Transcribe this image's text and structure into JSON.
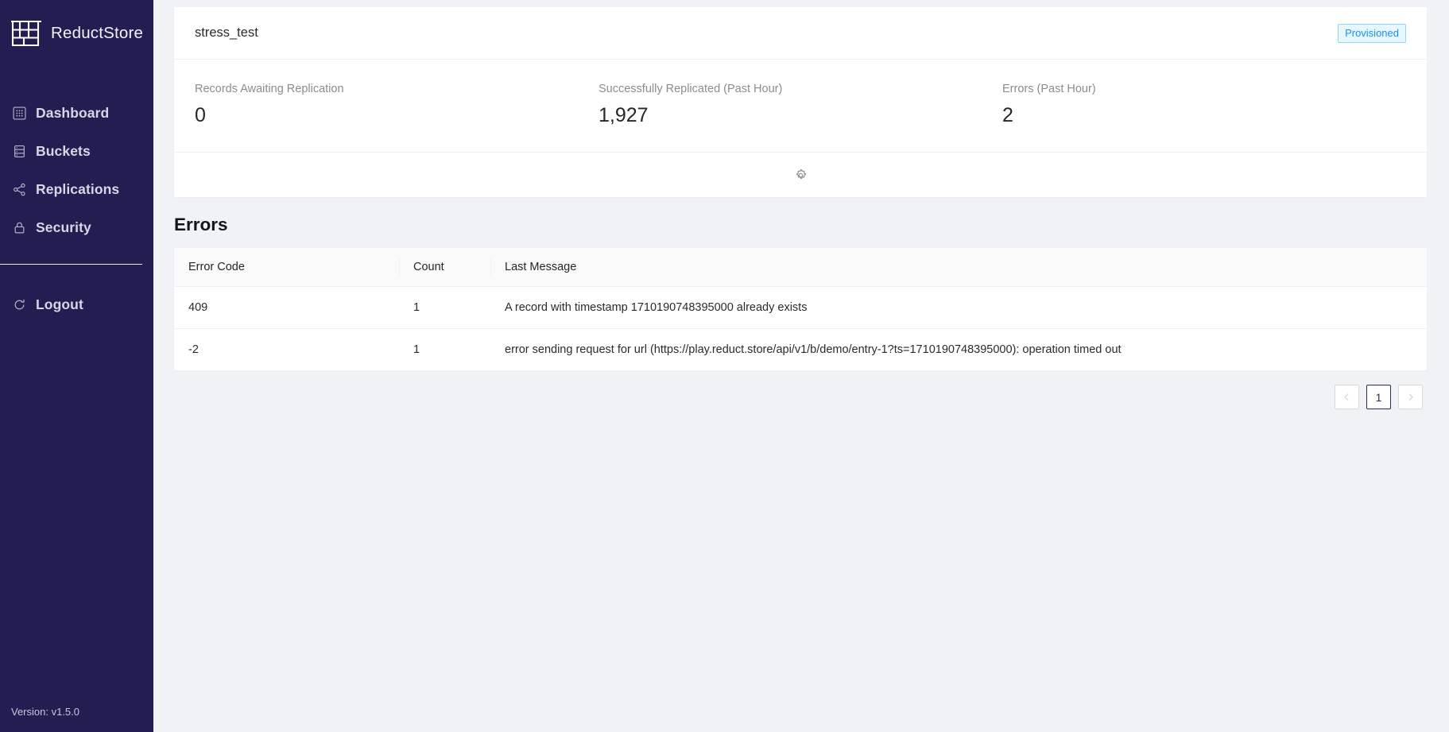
{
  "theme": {
    "sidebar_bg": "#231d52",
    "main_bg": "#f0f2f5",
    "card_bg": "#ffffff",
    "badge_text": "#1890ff",
    "badge_bg": "#e6f7ff",
    "badge_border": "#91d5ff",
    "active_page_border": "#2b2b52"
  },
  "sidebar": {
    "brand": {
      "name": "ReductStore",
      "logo_icon": "shelf-rack-logo-icon"
    },
    "items": [
      {
        "id": "dashboard",
        "label": "Dashboard",
        "icon": "dashboard-grid-icon"
      },
      {
        "id": "buckets",
        "label": "Buckets",
        "icon": "database-icon"
      },
      {
        "id": "replications",
        "label": "Replications",
        "icon": "share-nodes-icon"
      },
      {
        "id": "security",
        "label": "Security",
        "icon": "lock-icon"
      }
    ],
    "logout": {
      "label": "Logout",
      "icon": "logout-circle-icon"
    },
    "version": "Version: v1.5.0"
  },
  "replication_card": {
    "title": "stress_test",
    "status_badge": "Provisioned",
    "settings_icon": "gear-icon",
    "stats": [
      {
        "label": "Records Awaiting Replication",
        "value": "0"
      },
      {
        "label": "Successfully Replicated (Past Hour)",
        "value": "1,927"
      },
      {
        "label": "Errors (Past Hour)",
        "value": "2"
      }
    ]
  },
  "errors_section": {
    "title": "Errors",
    "columns": [
      "Error Code",
      "Count",
      "Last Message"
    ],
    "rows": [
      {
        "code": "409",
        "count": "1",
        "message": "A record with timestamp 1710190748395000 already exists"
      },
      {
        "code": "-2",
        "count": "1",
        "message": "error sending request for url (https://play.reduct.store/api/v1/b/demo/entry-1?ts=1710190748395000): operation timed out"
      }
    ],
    "pagination": {
      "prev_icon": "chevron-left-icon",
      "next_icon": "chevron-right-icon",
      "current_page": "1"
    }
  }
}
